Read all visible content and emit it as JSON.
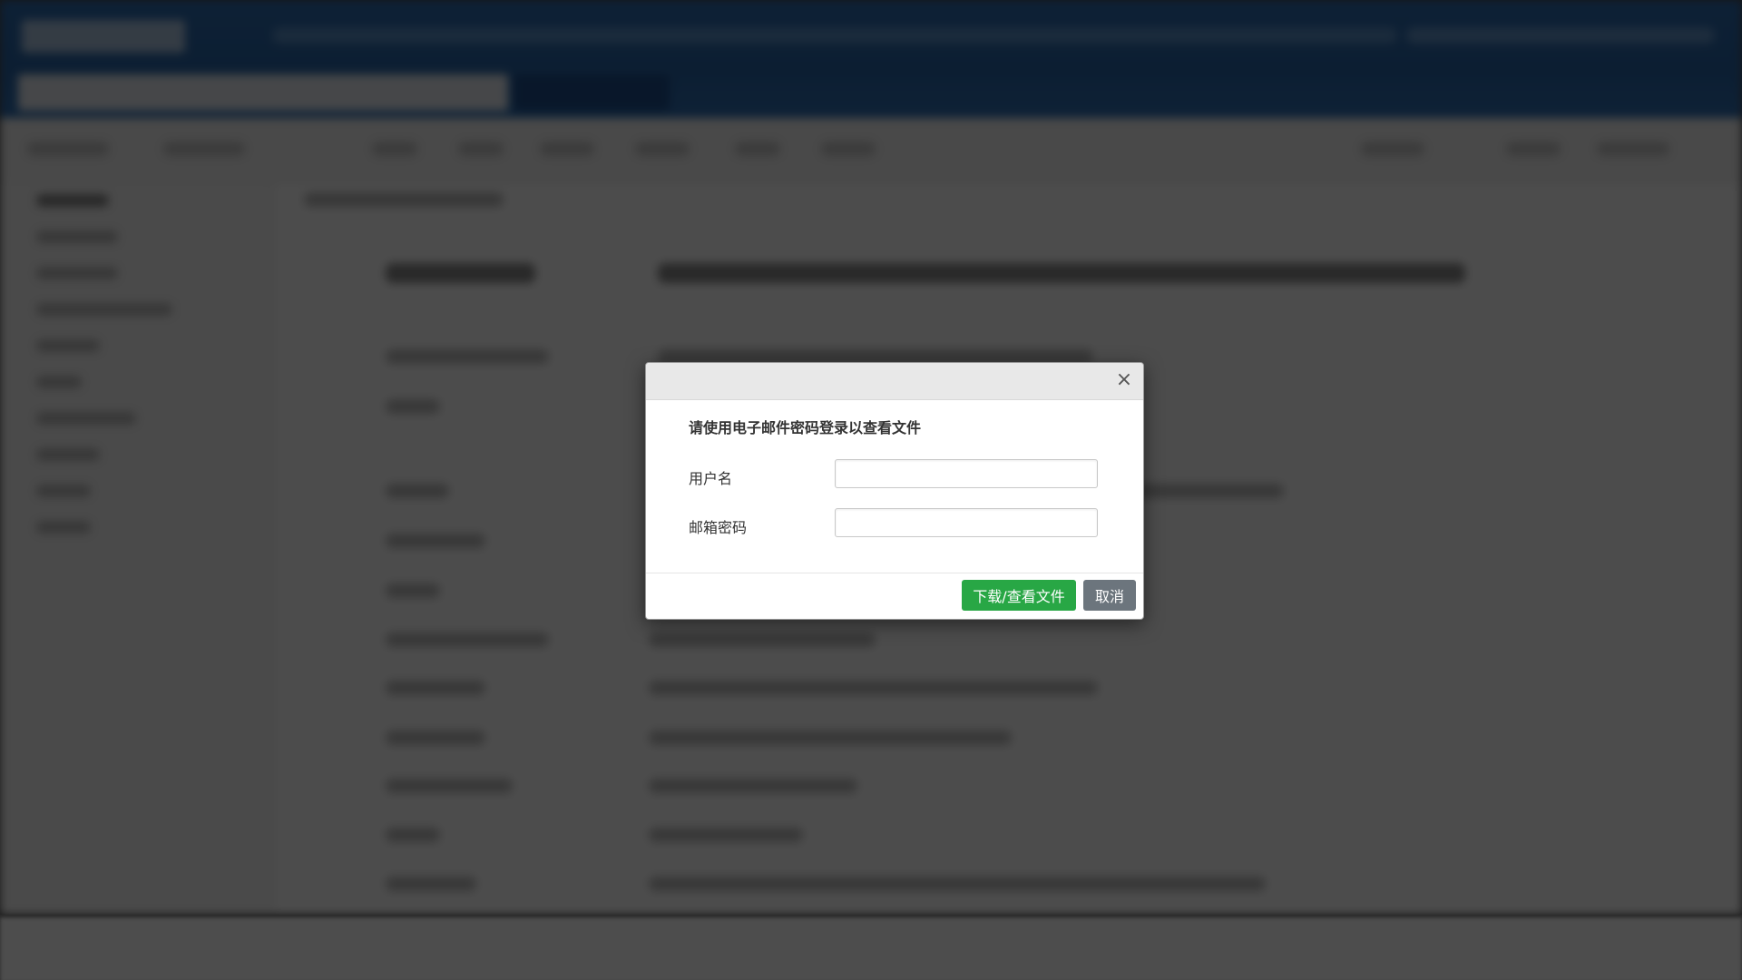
{
  "modal": {
    "title": "请使用电子邮件密码登录以查看文件",
    "close_glyph": "×",
    "username_label": "用户名",
    "username_value": "",
    "password_label": "邮箱密码",
    "password_value": "",
    "download_button": "下载/查看文件",
    "cancel_button": "取消"
  },
  "colors": {
    "overlay": "#000000",
    "download_button": "#28a745",
    "cancel_button": "#6c757d",
    "header_bar": "#2d6db3"
  }
}
